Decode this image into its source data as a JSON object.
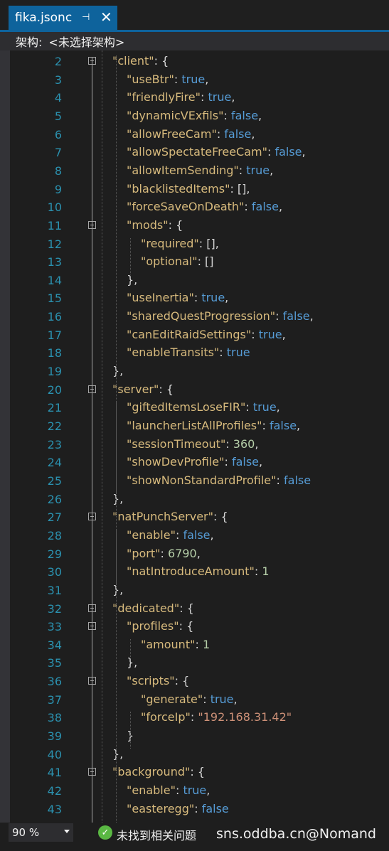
{
  "tab": {
    "title": "fika.jsonc",
    "pin_glyph": "⊣",
    "close_glyph": "✕"
  },
  "arch": {
    "label": "架构:",
    "value": "<未选择架构>"
  },
  "lines": [
    {
      "n": "2",
      "t": [
        [
          "\"client\"",
          "q"
        ],
        [
          ": {",
          "p"
        ]
      ]
    },
    {
      "n": "3",
      "t": [
        [
          "\"useBtr\"",
          "q"
        ],
        [
          ": ",
          "p"
        ],
        [
          "true",
          "b"
        ],
        [
          ",",
          "p"
        ]
      ]
    },
    {
      "n": "4",
      "t": [
        [
          "\"friendlyFire\"",
          "q"
        ],
        [
          ": ",
          "p"
        ],
        [
          "true",
          "b"
        ],
        [
          ",",
          "p"
        ]
      ]
    },
    {
      "n": "5",
      "t": [
        [
          "\"dynamicVExfils\"",
          "q"
        ],
        [
          ": ",
          "p"
        ],
        [
          "false",
          "b"
        ],
        [
          ",",
          "p"
        ]
      ]
    },
    {
      "n": "6",
      "t": [
        [
          "\"allowFreeCam\"",
          "q"
        ],
        [
          ": ",
          "p"
        ],
        [
          "false",
          "b"
        ],
        [
          ",",
          "p"
        ]
      ]
    },
    {
      "n": "7",
      "t": [
        [
          "\"allowSpectateFreeCam\"",
          "q"
        ],
        [
          ": ",
          "p"
        ],
        [
          "false",
          "b"
        ],
        [
          ",",
          "p"
        ]
      ]
    },
    {
      "n": "8",
      "t": [
        [
          "\"allowItemSending\"",
          "q"
        ],
        [
          ": ",
          "p"
        ],
        [
          "true",
          "b"
        ],
        [
          ",",
          "p"
        ]
      ]
    },
    {
      "n": "9",
      "t": [
        [
          "\"blacklistedItems\"",
          "q"
        ],
        [
          ": [],",
          "p"
        ]
      ]
    },
    {
      "n": "10",
      "t": [
        [
          "\"forceSaveOnDeath\"",
          "q"
        ],
        [
          ": ",
          "p"
        ],
        [
          "false",
          "b"
        ],
        [
          ",",
          "p"
        ]
      ]
    },
    {
      "n": "11",
      "t": [
        [
          "\"mods\"",
          "q"
        ],
        [
          ": {",
          "p"
        ]
      ]
    },
    {
      "n": "12",
      "t": [
        [
          "\"required\"",
          "q"
        ],
        [
          ": [],",
          "p"
        ]
      ]
    },
    {
      "n": "13",
      "t": [
        [
          "\"optional\"",
          "q"
        ],
        [
          ": []",
          "p"
        ]
      ]
    },
    {
      "n": "14",
      "t": [
        [
          "},",
          "p"
        ]
      ]
    },
    {
      "n": "15",
      "t": [
        [
          "\"useInertia\"",
          "q"
        ],
        [
          ": ",
          "p"
        ],
        [
          "true",
          "b"
        ],
        [
          ",",
          "p"
        ]
      ]
    },
    {
      "n": "16",
      "t": [
        [
          "\"sharedQuestProgression\"",
          "q"
        ],
        [
          ": ",
          "p"
        ],
        [
          "false",
          "b"
        ],
        [
          ",",
          "p"
        ]
      ]
    },
    {
      "n": "17",
      "t": [
        [
          "\"canEditRaidSettings\"",
          "q"
        ],
        [
          ": ",
          "p"
        ],
        [
          "true",
          "b"
        ],
        [
          ",",
          "p"
        ]
      ]
    },
    {
      "n": "18",
      "t": [
        [
          "\"enableTransits\"",
          "q"
        ],
        [
          ": ",
          "p"
        ],
        [
          "true",
          "b"
        ]
      ]
    },
    {
      "n": "19",
      "t": [
        [
          "},",
          "p"
        ]
      ]
    },
    {
      "n": "20",
      "t": [
        [
          "\"server\"",
          "q"
        ],
        [
          ": {",
          "p"
        ]
      ]
    },
    {
      "n": "21",
      "t": [
        [
          "\"giftedItemsLoseFIR\"",
          "q"
        ],
        [
          ": ",
          "p"
        ],
        [
          "true",
          "b"
        ],
        [
          ",",
          "p"
        ]
      ]
    },
    {
      "n": "22",
      "t": [
        [
          "\"launcherListAllProfiles\"",
          "q"
        ],
        [
          ": ",
          "p"
        ],
        [
          "false",
          "b"
        ],
        [
          ",",
          "p"
        ]
      ]
    },
    {
      "n": "23",
      "t": [
        [
          "\"sessionTimeout\"",
          "q"
        ],
        [
          ": ",
          "p"
        ],
        [
          "360",
          "n"
        ],
        [
          ",",
          "p"
        ]
      ]
    },
    {
      "n": "24",
      "t": [
        [
          "\"showDevProfile\"",
          "q"
        ],
        [
          ": ",
          "p"
        ],
        [
          "false",
          "b"
        ],
        [
          ",",
          "p"
        ]
      ]
    },
    {
      "n": "25",
      "t": [
        [
          "\"showNonStandardProfile\"",
          "q"
        ],
        [
          ": ",
          "p"
        ],
        [
          "false",
          "b"
        ]
      ]
    },
    {
      "n": "26",
      "t": [
        [
          "},",
          "p"
        ]
      ]
    },
    {
      "n": "27",
      "t": [
        [
          "\"natPunchServer\"",
          "q"
        ],
        [
          ": {",
          "p"
        ]
      ]
    },
    {
      "n": "28",
      "t": [
        [
          "\"enable\"",
          "q"
        ],
        [
          ": ",
          "p"
        ],
        [
          "false",
          "b"
        ],
        [
          ",",
          "p"
        ]
      ]
    },
    {
      "n": "29",
      "t": [
        [
          "\"port\"",
          "q"
        ],
        [
          ": ",
          "p"
        ],
        [
          "6790",
          "n"
        ],
        [
          ",",
          "p"
        ]
      ]
    },
    {
      "n": "30",
      "t": [
        [
          "\"natIntroduceAmount\"",
          "q"
        ],
        [
          ": ",
          "p"
        ],
        [
          "1",
          "n"
        ]
      ]
    },
    {
      "n": "31",
      "t": [
        [
          "},",
          "p"
        ]
      ]
    },
    {
      "n": "32",
      "t": [
        [
          "\"dedicated\"",
          "q"
        ],
        [
          ": {",
          "p"
        ]
      ]
    },
    {
      "n": "33",
      "t": [
        [
          "\"profiles\"",
          "q"
        ],
        [
          ": {",
          "p"
        ]
      ]
    },
    {
      "n": "34",
      "t": [
        [
          "\"amount\"",
          "q"
        ],
        [
          ": ",
          "p"
        ],
        [
          "1",
          "n"
        ]
      ]
    },
    {
      "n": "35",
      "t": [
        [
          "},",
          "p"
        ]
      ]
    },
    {
      "n": "36",
      "t": [
        [
          "\"scripts\"",
          "q"
        ],
        [
          ": {",
          "p"
        ]
      ]
    },
    {
      "n": "37",
      "t": [
        [
          "\"generate\"",
          "q"
        ],
        [
          ": ",
          "p"
        ],
        [
          "true",
          "b"
        ],
        [
          ",",
          "p"
        ]
      ]
    },
    {
      "n": "38",
      "t": [
        [
          "\"forceIp\"",
          "q"
        ],
        [
          ": ",
          "p"
        ],
        [
          "\"192.168.31.42\"",
          "s"
        ]
      ]
    },
    {
      "n": "39",
      "t": [
        [
          "}",
          "p"
        ]
      ]
    },
    {
      "n": "40",
      "t": [
        [
          "},",
          "p"
        ]
      ]
    },
    {
      "n": "41",
      "t": [
        [
          "\"background\"",
          "q"
        ],
        [
          ": {",
          "p"
        ]
      ]
    },
    {
      "n": "42",
      "t": [
        [
          "\"enable\"",
          "q"
        ],
        [
          ": ",
          "p"
        ],
        [
          "true",
          "b"
        ],
        [
          ",",
          "p"
        ]
      ]
    },
    {
      "n": "43",
      "t": [
        [
          "\"easteregg\"",
          "q"
        ],
        [
          ": ",
          "p"
        ],
        [
          "false",
          "b"
        ]
      ]
    }
  ],
  "status": {
    "zoom": "90 %",
    "message": "未找到相关问题",
    "ok_glyph": "✓"
  },
  "watermark": "sns.oddba.cn@Nomand",
  "colors": {
    "accent": "#0e639c",
    "key": "#d7ba7d",
    "keyword": "#569cd6",
    "number": "#b5cea8",
    "string": "#ce9178",
    "line_number": "#2b91af",
    "ok": "#5ab843"
  }
}
